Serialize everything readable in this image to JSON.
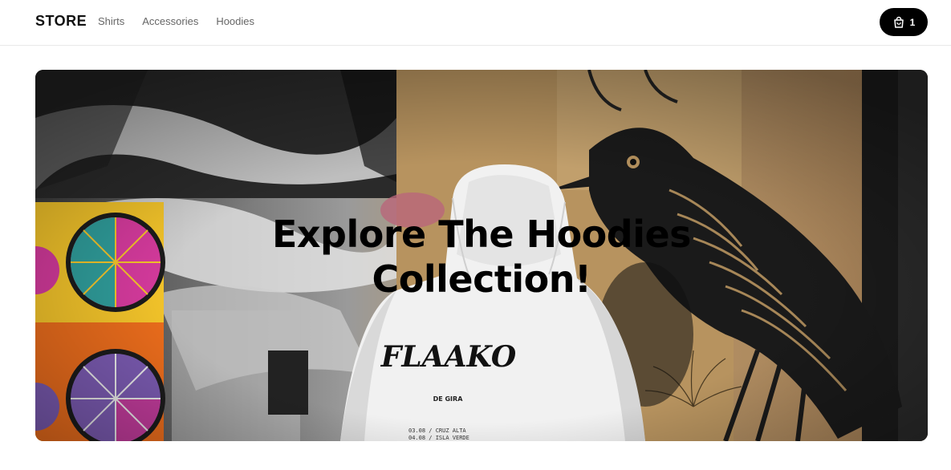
{
  "navbar": {
    "brand": "STORE",
    "links": [
      "Shirts",
      "Accessories",
      "Hoodies"
    ],
    "cart": {
      "icon": "shopping-bag-icon",
      "count": "1"
    }
  },
  "hero": {
    "title_line1": "Explore The Hoodies",
    "title_line2": "Collection!",
    "hoodie_print": {
      "logo": "FLAAKO",
      "subtitle": "DE GIRA",
      "dates": [
        "03.08 / CRUZ ALTA",
        "04.08 / ISLA VERDE"
      ]
    }
  },
  "colors": {
    "cart_bg": "#000000",
    "nav_text": "#666666",
    "brand_text": "#111111"
  }
}
